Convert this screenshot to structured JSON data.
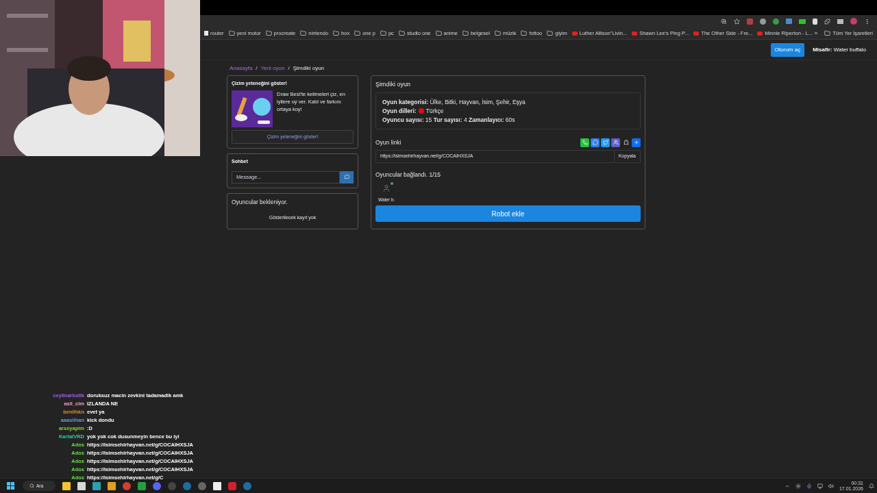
{
  "bookmarks": [
    {
      "label": "router",
      "kind": "site"
    },
    {
      "label": "yeni motor",
      "kind": "folder"
    },
    {
      "label": "procreate",
      "kind": "folder"
    },
    {
      "label": "nintendo",
      "kind": "folder"
    },
    {
      "label": "box",
      "kind": "folder"
    },
    {
      "label": "one p",
      "kind": "folder"
    },
    {
      "label": "pc",
      "kind": "folder"
    },
    {
      "label": "studio one",
      "kind": "folder"
    },
    {
      "label": "anime",
      "kind": "folder"
    },
    {
      "label": "belgesel",
      "kind": "folder"
    },
    {
      "label": "müzik",
      "kind": "folder"
    },
    {
      "label": "fottoo",
      "kind": "folder"
    },
    {
      "label": "giyim",
      "kind": "folder"
    },
    {
      "label": "Luther Allison\"Livin...",
      "kind": "video"
    },
    {
      "label": "Shawn Lee's Ping P...",
      "kind": "video"
    },
    {
      "label": "The Other Side - Fre...",
      "kind": "video"
    },
    {
      "label": "Minnie Riperton - L...",
      "kind": "video"
    }
  ],
  "more_bookmarks": "»",
  "all_bookmarks": "Tüm Yer İşaretleri",
  "header": {
    "login_button": "Oturum aç",
    "guest_label": "Misafir:",
    "guest_name": "Water buffalo"
  },
  "breadcrumb_separator": "/",
  "breadcrumb": [
    {
      "label": "Anasayfa",
      "selected": false
    },
    {
      "label": "Yeni oyun",
      "selected": false
    },
    {
      "label": "Şimdiki oyun",
      "selected": true
    }
  ],
  "promo": {
    "title": "Çizim yeteneğini göster!",
    "description": "Draw Best'te kelimeleri çiz, en iyilere oy ver. Katıl ve farkını ortaya koy!",
    "button": "Çizim yeteneğini göster!"
  },
  "chat": {
    "title": "Sohbet",
    "placeholder": "Message..."
  },
  "waiting": {
    "title": "Oyuncular bekleniyor.",
    "empty": "Gösterilecek kayıt yok"
  },
  "game": {
    "title": "Şimdiki oyun",
    "info": [
      {
        "kind": "text",
        "text": "**Oyun kategorisi:** Ülke, Bitki, Hayvan, İsim, Şehir, Eşya"
      },
      {
        "kind": "language",
        "label": "Oyun dilleri:",
        "value": "Türkçe"
      },
      {
        "kind": "text",
        "text": "**Oyuncu sayısı:** 15 **Tur sayısı:** 4 **Zamanlayıcı:** 60s"
      }
    ],
    "link_label": "Oyun linki",
    "link": "https://isimsehirhayvan.net/g/COCAIHXSJA",
    "copy_button": "Kopyala",
    "players_label": "Oyuncular bağlandı. 1/15",
    "players": [
      {
        "name": "Water b.",
        "online": true
      }
    ],
    "robot_button": "Robot ekle"
  },
  "stream_chat": [
    {
      "user": "ceylinarkotik",
      "color": "#a35de8",
      "text": "doruksuz macin zevkini tadamadik amk"
    },
    {
      "user": "asli_cim",
      "color": "#f0a0c0",
      "text": "IZLANDA NE"
    },
    {
      "user": "benlihkn",
      "color": "#e0902a",
      "text": "evet ya"
    },
    {
      "user": "aaaslihan",
      "color": "#6a9ad8",
      "text": "kick dondu"
    },
    {
      "user": "arseyapim",
      "color": "#8ad030",
      "text": ":D"
    },
    {
      "user": "KartalVRD",
      "color": "#3ac8a0",
      "text": "yok yok cok dusunmeyin bence bu iyi"
    },
    {
      "user": "Ados",
      "color": "#5ee03a",
      "text": "https://isimsehirhayvan.net/g/COCAIHXSJA"
    },
    {
      "user": "Ados",
      "color": "#5ee03a",
      "text": "https://isimsehirhayvan.net/g/COCAIHXSJA"
    },
    {
      "user": "Ados",
      "color": "#5ee03a",
      "text": "https://isimsehirhayvan.net/g/COCAIHXSJA"
    },
    {
      "user": "Ados",
      "color": "#5ee03a",
      "text": "https://isimsehirhayvan.net/g/COCAIHXSJA"
    },
    {
      "user": "Ados",
      "color": "#5ee03a",
      "text": "https://isimsehirhayvan.net/g/C"
    }
  ],
  "taskbar": {
    "search": "Ara",
    "time": "00:31",
    "date": "17.01.2026"
  }
}
